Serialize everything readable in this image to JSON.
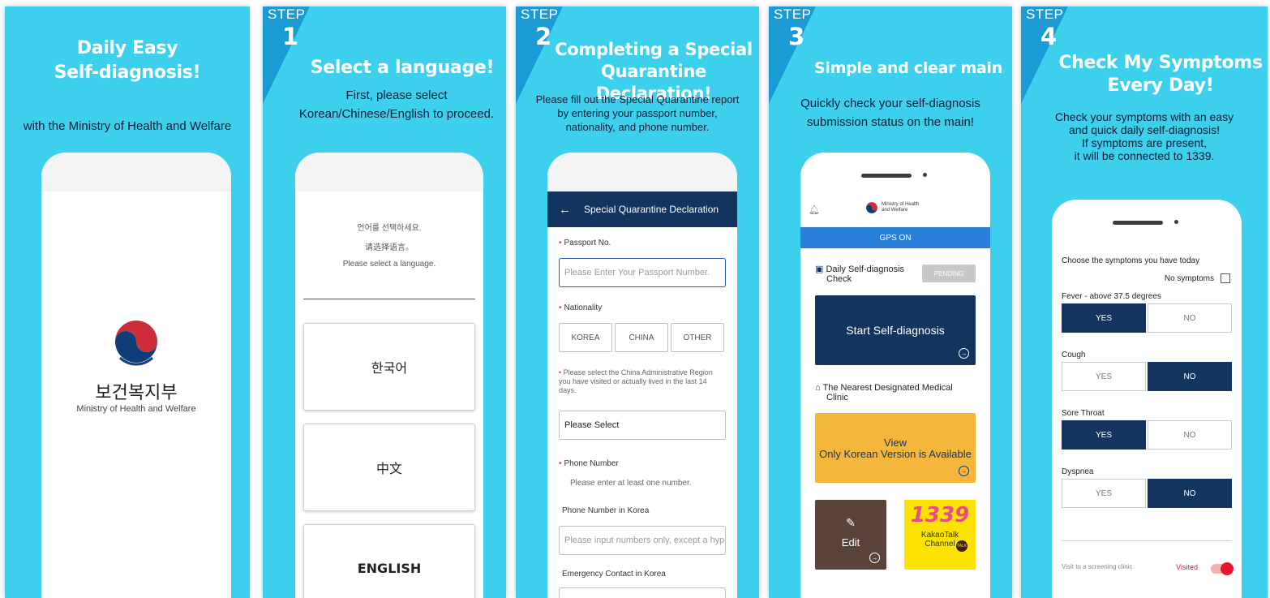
{
  "panels": [
    {
      "title_lines": [
        "Daily Easy",
        "Self-diagnosis!"
      ],
      "description_lines": [
        "with the Ministry of Health and Welfare"
      ],
      "phone": {
        "org_korean": "보건복지부",
        "org_english": "Ministry of Health and Welfare"
      }
    },
    {
      "step_word": "STEP",
      "step_number": "1",
      "title_lines": [
        "Select a language!"
      ],
      "description_lines": [
        "First, please select",
        "Korean/Chinese/English to proceed."
      ],
      "phone": {
        "prompts": [
          "언어를 선택하세요.",
          "请选择语言。",
          "Please select a language."
        ],
        "languages": [
          "한국어",
          "中文",
          "ENGLISH"
        ]
      }
    },
    {
      "step_word": "STEP",
      "step_number": "2",
      "title_lines": [
        "Completing a Special",
        "Quarantine Declaration!"
      ],
      "description_lines": [
        "Please fill out the Special Quarantine report",
        "by entering your passport number,",
        "nationality, and phone number."
      ],
      "phone": {
        "back_icon": "←",
        "appbar_title": "Special Quarantine Declaration",
        "passport_label": "Passport No.",
        "passport_placeholder": "Please Enter Your Passport Number.",
        "nationality_label": "Nationality",
        "nationality_options": [
          "KOREA",
          "CHINA",
          "OTHER"
        ],
        "region_note": "Please select the China Administrative Region you have visited or actually lived in the last 14 days.",
        "region_select": "Please Select",
        "phone_label": "Phone Number",
        "phone_hint": "Please enter at least one number.",
        "phone_korea_label": "Phone Number in Korea",
        "phone_korea_placeholder": "Please input numbers only, except a hyp",
        "emergency_label": "Emergency Contact in Korea"
      }
    },
    {
      "step_word": "STEP",
      "step_number": "3",
      "title_lines": [
        "Simple and clear main"
      ],
      "description_lines": [
        "Quickly check your self-diagnosis",
        "submission status on the main!"
      ],
      "phone": {
        "header_org_lines": [
          "Ministry of Health",
          "and Welfare"
        ],
        "gps_status": "GPS ON",
        "daily_check_lines": [
          "Daily Self-diagnosis",
          "Check"
        ],
        "status_badge": "PENDING",
        "start_button": "Start Self-diagnosis",
        "clinic_title_lines": [
          "The Nearest Designated Medical",
          "Clinic"
        ],
        "view_title": "View",
        "view_subtitle": "Only Korean Version is Available",
        "edit_label": "Edit",
        "kakao_number": "1339",
        "kakao_lines": [
          "KakaoTalk",
          "Channel"
        ],
        "kakao_badge": "TALK"
      }
    },
    {
      "step_word": "STEP",
      "step_number": "4",
      "title_lines": [
        "Check My Symptoms",
        "Every Day!"
      ],
      "description_lines": [
        "Check your symptoms with an easy",
        "and quick daily self-diagnosis!",
        "If symptoms are present,",
        "it will be connected to 1339."
      ],
      "phone": {
        "heading": "Choose the symptoms you have today",
        "no_symptoms_label": "No symptoms",
        "symptoms": [
          {
            "label": "Fever - above 37.5 degrees",
            "yes": "YES",
            "no": "NO",
            "selected": "YES"
          },
          {
            "label": "Cough",
            "yes": "YES",
            "no": "NO",
            "selected": "NO"
          },
          {
            "label": "Sore Throat",
            "yes": "YES",
            "no": "NO",
            "selected": "YES"
          },
          {
            "label": "Dyspnea",
            "yes": "YES",
            "no": "NO",
            "selected": "NO"
          }
        ],
        "screening_label": "Visit to a screening clinic",
        "screening_status": "Visited"
      }
    }
  ],
  "colors": {
    "panel_bg": "#3dd0ec",
    "ribbon": "#1a9bd6",
    "navy": "#13345e",
    "gps_blue": "#2a7fd8",
    "view_yellow": "#f4b73b",
    "kakao_yellow": "#fbe200",
    "edit_brown": "#5a4339",
    "accent_red": "#e8162c"
  }
}
